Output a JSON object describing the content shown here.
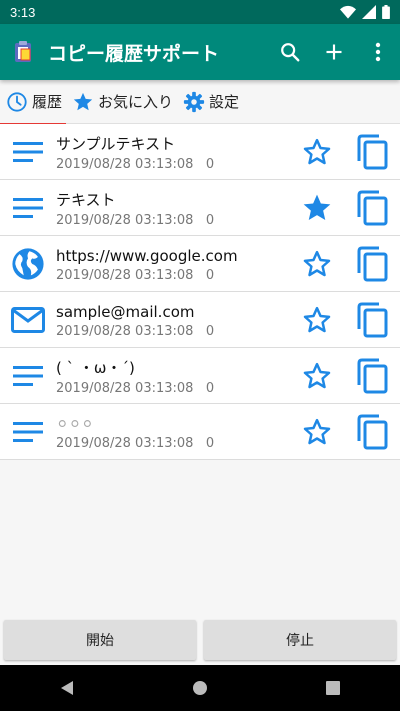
{
  "status": {
    "time": "3:13"
  },
  "app": {
    "title": "コピー履歴サポート",
    "actions": [
      "search-icon",
      "add-icon",
      "more-vert-icon"
    ]
  },
  "tabs": [
    {
      "label": "履歴",
      "icon": "history-icon",
      "active": true
    },
    {
      "label": "お気に入り",
      "icon": "star-icon",
      "active": false
    },
    {
      "label": "設定",
      "icon": "gear-icon",
      "active": false
    }
  ],
  "history": [
    {
      "text": "サンプルテキスト",
      "date": "2019/08/28 03:13:08",
      "count": "0",
      "type": "text-lines-icon",
      "favorite": false
    },
    {
      "text": "テキスト",
      "date": "2019/08/28 03:13:08",
      "count": "0",
      "type": "text-lines-icon",
      "favorite": true
    },
    {
      "text": "https://www.google.com",
      "date": "2019/08/28 03:13:08",
      "count": "0",
      "type": "globe-icon",
      "favorite": false
    },
    {
      "text": "sample@mail.com",
      "date": "2019/08/28 03:13:08",
      "count": "0",
      "type": "mail-icon",
      "favorite": false
    },
    {
      "text": "( ˋ ・ω・ˊ)",
      "date": "2019/08/28 03:13:08",
      "count": "0",
      "type": "text-lines-icon",
      "favorite": false
    },
    {
      "text": "⚪⚪⚪",
      "date": "2019/08/28 03:13:08",
      "count": "0",
      "type": "text-lines-icon",
      "favorite": false
    }
  ],
  "buttons": {
    "start": "開始",
    "stop": "停止"
  },
  "colors": {
    "appbar": "#00897b",
    "statusbar": "#00695c",
    "accent": "#2196f3",
    "tab_indicator": "#e53935"
  }
}
